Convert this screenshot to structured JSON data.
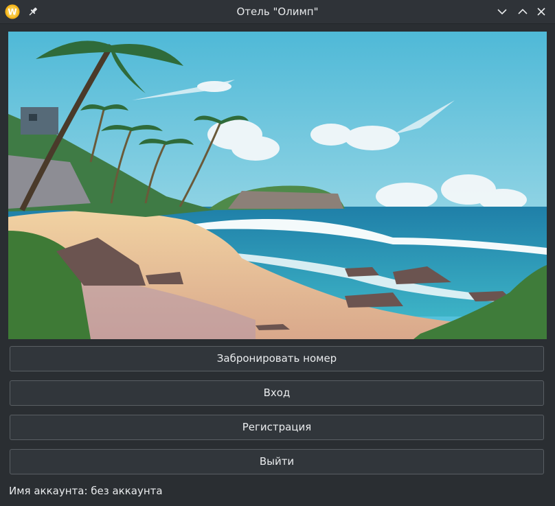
{
  "window": {
    "title": "Отель \"Олимп\"",
    "icons": [
      "app-logo-icon",
      "pin-icon",
      "minimize-icon",
      "maximize-icon",
      "close-icon"
    ]
  },
  "hero_image": {
    "subject": "Иллюстрация тропического пляжа с пальмами и морем"
  },
  "actions": {
    "book_label": "Забронировать номер",
    "login_label": "Вход",
    "register_label": "Регистрация",
    "exit_label": "Выйти"
  },
  "status": {
    "account_text": "Имя аккаунта: без аккаунта"
  },
  "colors": {
    "window_bg": "#2a2e32",
    "button_bg": "#31363b",
    "button_border": "#5a5f64",
    "text": "#e8eaec",
    "app_logo": "#f4b41a"
  }
}
